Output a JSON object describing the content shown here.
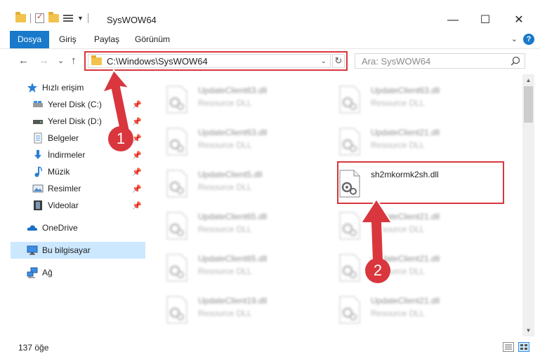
{
  "window": {
    "title": "SysWOW64",
    "minimize_glyph": "—",
    "maximize_glyph": "☐",
    "close_glyph": "✕"
  },
  "ribbon": {
    "tabs": [
      "Dosya",
      "Giriş",
      "Paylaş",
      "Görünüm"
    ],
    "help_glyph": "?",
    "collapse_glyph": "⌄"
  },
  "navigation": {
    "back_glyph": "←",
    "forward_glyph": "→",
    "recent_glyph": "⌄",
    "up_glyph": "↑"
  },
  "address": {
    "path": "C:\\Windows\\SysWOW64",
    "dropdown_glyph": "⌄",
    "refresh_glyph": "↻"
  },
  "search": {
    "placeholder": "Ara: SysWOW64"
  },
  "sidebar": {
    "quick_access": "Hızlı erişim",
    "items": [
      {
        "label": "Yerel Disk (C:)",
        "icon": "drive-icon"
      },
      {
        "label": "Yerel Disk (D:)",
        "icon": "drive-icon"
      },
      {
        "label": "Belgeler",
        "icon": "documents-icon"
      },
      {
        "label": "İndirmeler",
        "icon": "downloads-icon"
      },
      {
        "label": "Müzik",
        "icon": "music-icon"
      },
      {
        "label": "Resimler",
        "icon": "pictures-icon"
      },
      {
        "label": "Videolar",
        "icon": "videos-icon"
      }
    ],
    "onedrive": "OneDrive",
    "this_pc": "Bu bilgisayar",
    "network": "Ağ",
    "pin_glyph": "📌"
  },
  "files": {
    "left": [
      {
        "name": "UpdateClient63.dll",
        "type": "Resource DLL"
      },
      {
        "name": "UpdateClient63.dll",
        "type": "Resource DLL"
      },
      {
        "name": "UpdateClient5.dll",
        "type": "Resource DLL"
      },
      {
        "name": "UpdateClient65.dll",
        "type": "Resource DLL"
      },
      {
        "name": "UpdateClient65.dll",
        "type": "Resource DLL"
      },
      {
        "name": "UpdateClient19.dll",
        "type": "Resource DLL"
      }
    ],
    "right": [
      {
        "name": "UpdateClient63.dll",
        "type": "Resource DLL"
      },
      {
        "name": "UpdateClient21.dll",
        "type": "Resource DLL"
      },
      {
        "name": "sh2mkormk2sh.dll",
        "type": ""
      },
      {
        "name": "UpdateClient21.dll",
        "type": "Resource DLL"
      },
      {
        "name": "UpdateClient21.dll",
        "type": "Resource DLL"
      },
      {
        "name": "UpdateClient21.dll",
        "type": "Resource DLL"
      }
    ]
  },
  "annotations": {
    "marker1": "1",
    "marker2": "2",
    "accent_color": "#d9363e"
  },
  "status": {
    "item_count": "137 öğe"
  },
  "colors": {
    "ribbon_file_tab": "#1979ca",
    "selected_nav": "#cce8ff",
    "folder": "#f3c24d"
  }
}
